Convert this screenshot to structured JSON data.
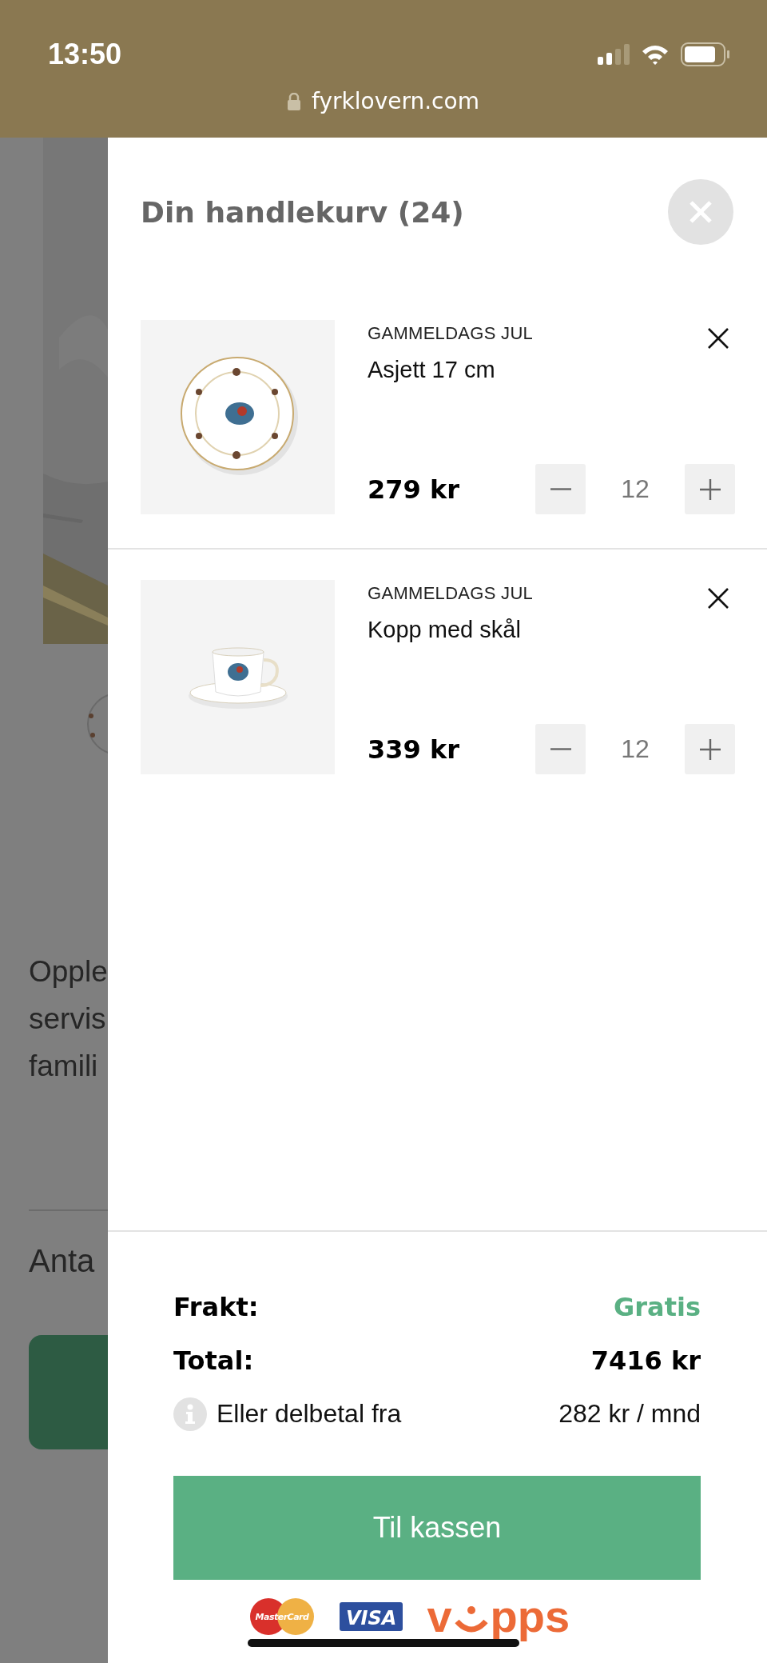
{
  "status_bar": {
    "time": "13:50",
    "url": "fyrklovern.com"
  },
  "background_page": {
    "text_lines": [
      "Opple",
      "servis",
      "famili"
    ],
    "label": "Anta"
  },
  "cart": {
    "title": "Din handlekurv (24)",
    "items": [
      {
        "category": "GAMMELDAGS JUL",
        "name": "Asjett 17 cm",
        "price": "279 kr",
        "quantity": "12",
        "kind": "plate"
      },
      {
        "category": "GAMMELDAGS JUL",
        "name": "Kopp med skål",
        "price": "339 kr",
        "quantity": "12",
        "kind": "cup"
      }
    ],
    "summary": [
      {
        "label": "Frakt:",
        "value": "Gratis",
        "kind": "highlight"
      },
      {
        "label": "Total:",
        "value": "7416 kr",
        "kind": "total"
      },
      {
        "label": "Eller delbetal fra",
        "value": "282 kr / mnd",
        "kind": "info"
      }
    ],
    "checkout_button": "Til kassen",
    "payment_logos": [
      {
        "kind": "mastercard",
        "text": "MasterCard"
      },
      {
        "kind": "visa",
        "text": "VISA"
      },
      {
        "kind": "vipps",
        "text": "v",
        "text_end": "pps"
      }
    ]
  }
}
